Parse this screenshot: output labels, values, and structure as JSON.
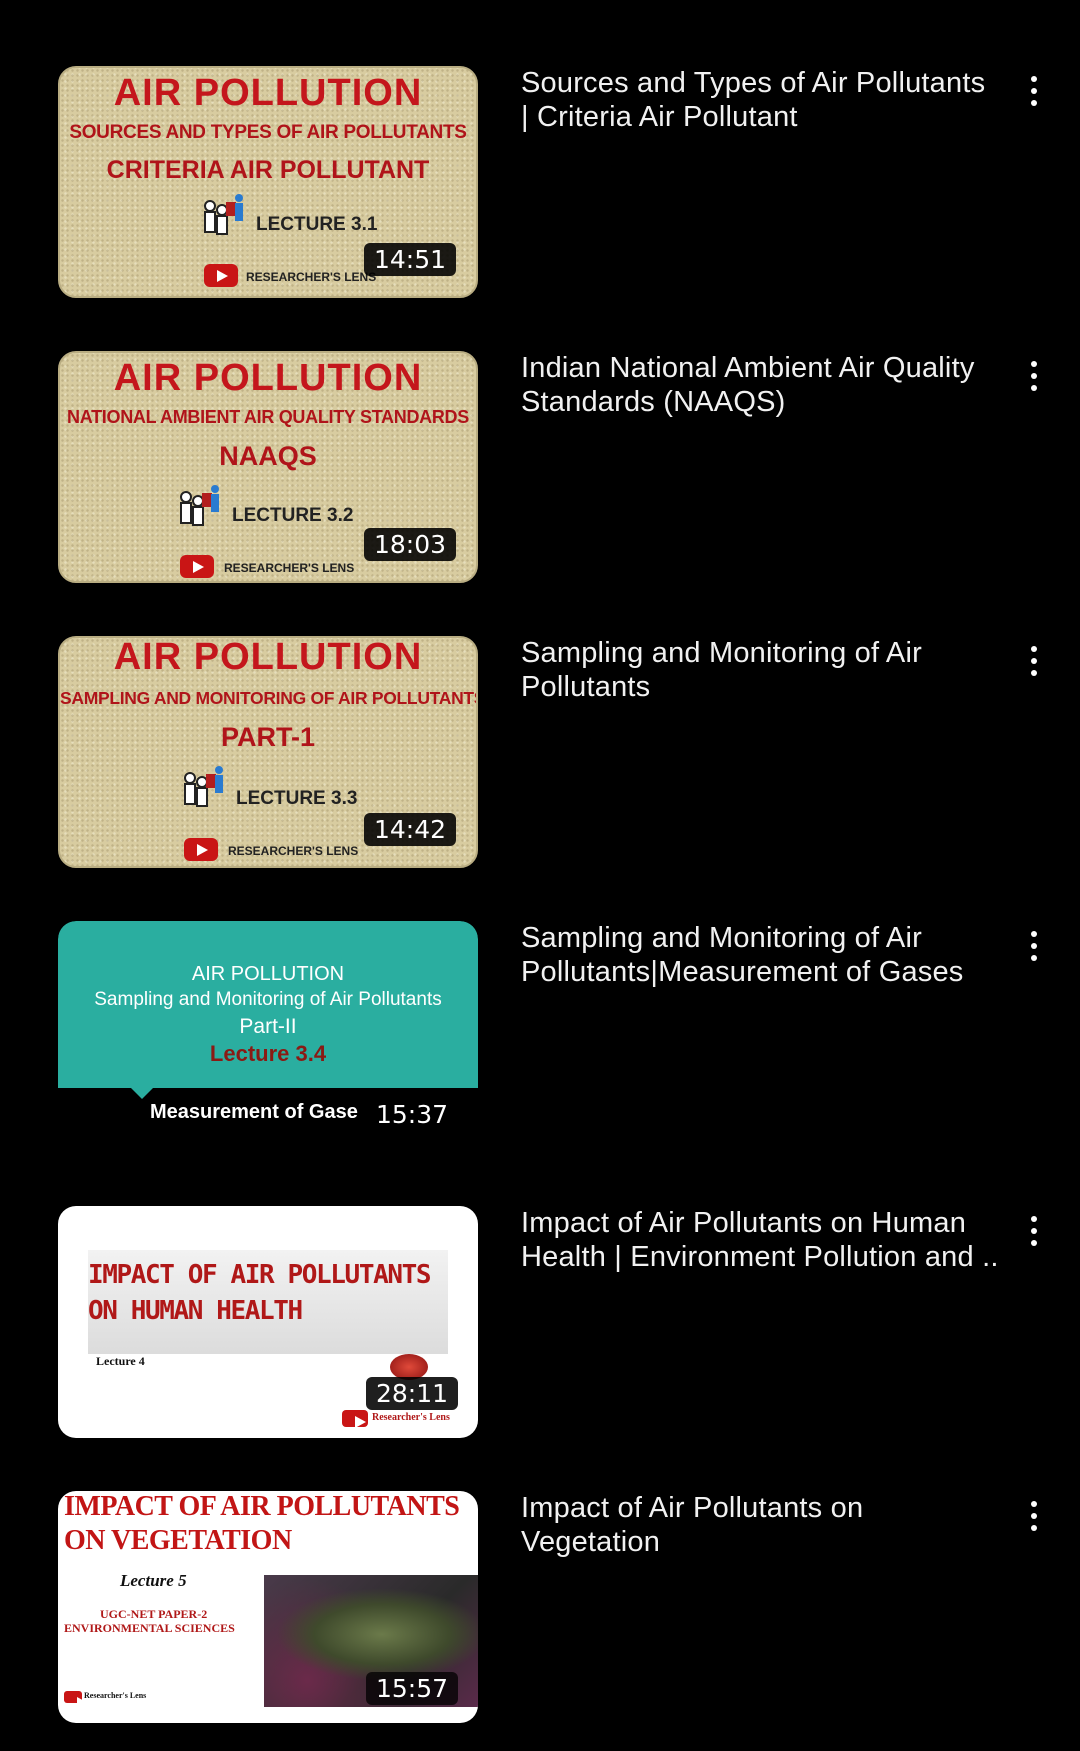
{
  "videos": [
    {
      "title_lines": [
        "Sources and Types of Air Pollutants",
        "| Criteria Air Pollutant"
      ],
      "duration": "14:51",
      "thumb": {
        "title": "AIR POLLUTION",
        "subtitle": "SOURCES AND TYPES OF AIR POLLUTANTS",
        "part": "CRITERIA AIR POLLUTANT",
        "lecture": "LECTURE 3.1",
        "brand": "RESEARCHER'S LENS"
      }
    },
    {
      "title_lines": [
        "Indian National Ambient Air Quality",
        "Standards (NAAQS)"
      ],
      "duration": "18:03",
      "thumb": {
        "title": "AIR POLLUTION",
        "subtitle": "NATIONAL AMBIENT AIR QUALITY STANDARDS",
        "part": "NAAQS",
        "lecture": "LECTURE 3.2",
        "brand": "RESEARCHER'S LENS"
      }
    },
    {
      "title_lines": [
        "Sampling and Monitoring of Air",
        "Pollutants"
      ],
      "duration": "14:42",
      "thumb": {
        "title": "AIR POLLUTION",
        "subtitle": "SAMPLING AND MONITORING OF AIR POLLUTANTS",
        "part": "PART-1",
        "lecture": "LECTURE 3.3",
        "brand": "RESEARCHER'S LENS"
      }
    },
    {
      "title_lines": [
        "Sampling and Monitoring of Air",
        "Pollutants|Measurement of Gases"
      ],
      "duration": "15:37",
      "thumb": {
        "title": "AIR POLLUTION",
        "subtitle": "Sampling and Monitoring of Air Pollutants",
        "part": "Part-II",
        "lecture": "Lecture 3.4",
        "caption": "Measurement of Gase"
      }
    },
    {
      "title_lines": [
        "Impact of Air Pollutants on Human",
        "Health | Environment Pollution and ..."
      ],
      "duration": "28:11",
      "thumb": {
        "line1": "IMPACT OF AIR POLLUTANTS",
        "line2": "ON HUMAN HEALTH",
        "lecture": "Lecture 4",
        "brand": "Researcher's Lens"
      }
    },
    {
      "title_lines": [
        "Impact of Air Pollutants on",
        "Vegetation"
      ],
      "duration": "15:57",
      "thumb": {
        "line1": "IMPACT OF AIR POLLUTANTS",
        "line2": "ON VEGETATION",
        "lecture": "Lecture 5",
        "exam1": "UGC-NET PAPER-2",
        "exam2": "ENVIRONMENTAL SCIENCES",
        "brand": "Researcher's Lens"
      }
    }
  ],
  "icons": {
    "more": "more-vert-icon",
    "play": "youtube-logo-icon",
    "people": "people-icon"
  }
}
